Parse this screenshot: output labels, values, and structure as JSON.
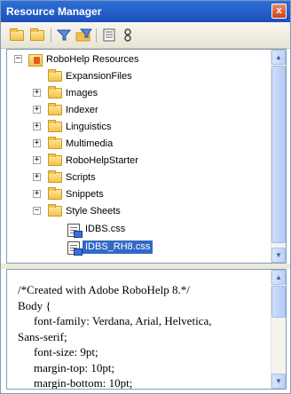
{
  "window": {
    "title": "Resource Manager",
    "close_glyph": "x"
  },
  "toolbar": {
    "buttons": [
      {
        "icon": "open-folder-icon"
      },
      {
        "icon": "folder-icon"
      },
      {
        "icon": "filter-icon"
      },
      {
        "icon": "filter-folder-icon"
      },
      {
        "icon": "properties-icon"
      },
      {
        "icon": "link-icon"
      }
    ]
  },
  "tree": {
    "root": {
      "label": "RoboHelp Resources",
      "expander": "−"
    },
    "folders": [
      {
        "label": "ExpansionFiles",
        "expander": ""
      },
      {
        "label": "Images",
        "expander": "+"
      },
      {
        "label": "Indexer",
        "expander": "+"
      },
      {
        "label": "Linguistics",
        "expander": "+"
      },
      {
        "label": "Multimedia",
        "expander": "+"
      },
      {
        "label": "RoboHelpStarter",
        "expander": "+"
      },
      {
        "label": "Scripts",
        "expander": "+"
      },
      {
        "label": "Snippets",
        "expander": "+"
      },
      {
        "label": "Style Sheets",
        "expander": "−"
      }
    ],
    "files": [
      {
        "label": "IDBS.css",
        "selected": false
      },
      {
        "label": "IDBS_RH8.css",
        "selected": true
      }
    ]
  },
  "preview": {
    "lines": [
      "/*Created with Adobe RoboHelp 8.*/",
      "Body {",
      "font-family: Verdana, Arial, Helvetica,",
      "Sans-serif;",
      "font-size: 9pt;",
      "margin-top: 10pt;",
      "margin-bottom: 10pt;"
    ]
  },
  "colors": {
    "title_bar": "#2f6fd9",
    "selection": "#316ac5",
    "close_button": "#c8431e"
  }
}
